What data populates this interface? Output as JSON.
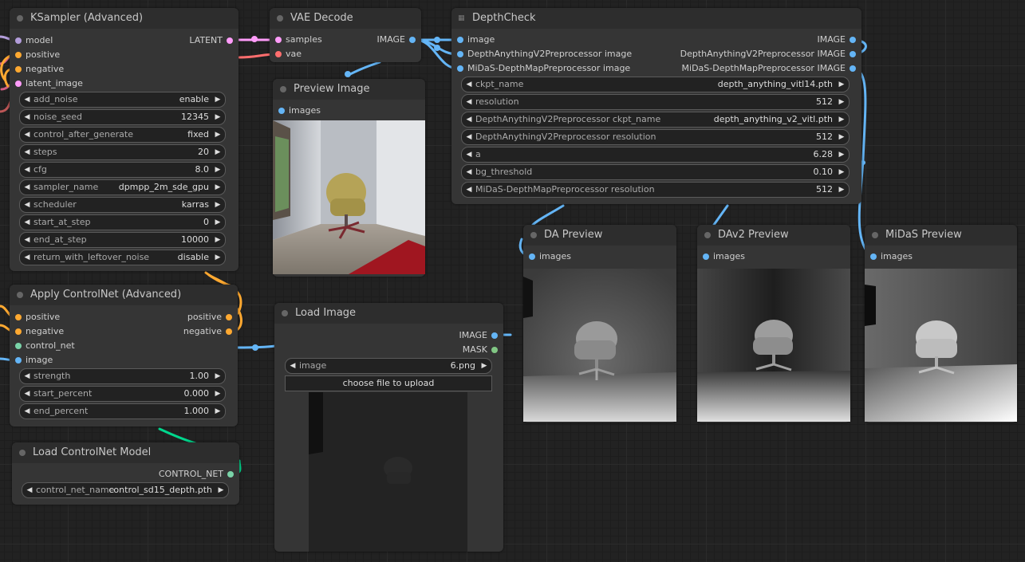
{
  "colors": {
    "model": "#b39ddb",
    "conditioning": "#ffa931",
    "latent": "#ff9cf9",
    "vae": "#ff6e6e",
    "image": "#64b5f6",
    "mask": "#81c784",
    "control_net": "#00d78d"
  },
  "ksampler": {
    "title": "KSampler (Advanced)",
    "inputs": [
      "model",
      "positive",
      "negative",
      "latent_image"
    ],
    "output": "LATENT",
    "widgets": [
      {
        "label": "add_noise",
        "value": "enable"
      },
      {
        "label": "noise_seed",
        "value": "12345"
      },
      {
        "label": "control_after_generate",
        "value": "fixed"
      },
      {
        "label": "steps",
        "value": "20"
      },
      {
        "label": "cfg",
        "value": "8.0"
      },
      {
        "label": "sampler_name",
        "value": "dpmpp_2m_sde_gpu"
      },
      {
        "label": "scheduler",
        "value": "karras"
      },
      {
        "label": "start_at_step",
        "value": "0"
      },
      {
        "label": "end_at_step",
        "value": "10000"
      },
      {
        "label": "return_with_leftover_noise",
        "value": "disable"
      }
    ]
  },
  "vae_decode": {
    "title": "VAE Decode",
    "inputs": [
      "samples",
      "vae"
    ],
    "output": "IMAGE"
  },
  "preview_image": {
    "title": "Preview Image",
    "input": "images"
  },
  "depth_check": {
    "title": "DepthCheck",
    "inputs": [
      "image",
      "DepthAnythingV2Preprocessor image",
      "MiDaS-DepthMapPreprocessor image"
    ],
    "outputs": [
      "IMAGE",
      "DepthAnythingV2Preprocessor IMAGE",
      "MiDaS-DepthMapPreprocessor IMAGE"
    ],
    "widgets": [
      {
        "label": "ckpt_name",
        "value": "depth_anything_vitl14.pth"
      },
      {
        "label": "resolution",
        "value": "512"
      },
      {
        "label": "DepthAnythingV2Preprocessor ckpt_name",
        "value": "depth_anything_v2_vitl.pth"
      },
      {
        "label": "DepthAnythingV2Preprocessor resolution",
        "value": "512"
      },
      {
        "label": "a",
        "value": "6.28"
      },
      {
        "label": "bg_threshold",
        "value": "0.10"
      },
      {
        "label": "MiDaS-DepthMapPreprocessor resolution",
        "value": "512"
      }
    ]
  },
  "apply_controlnet": {
    "title": "Apply ControlNet (Advanced)",
    "inputs": [
      "positive",
      "negative",
      "control_net",
      "image"
    ],
    "outputs": [
      "positive",
      "negative"
    ],
    "widgets": [
      {
        "label": "strength",
        "value": "1.00"
      },
      {
        "label": "start_percent",
        "value": "0.000"
      },
      {
        "label": "end_percent",
        "value": "1.000"
      }
    ]
  },
  "load_controlnet": {
    "title": "Load ControlNet Model",
    "output": "CONTROL_NET",
    "widget": {
      "label": "control_net_name",
      "value": "control_sd15_depth.pth"
    }
  },
  "load_image": {
    "title": "Load Image",
    "outputs": [
      "IMAGE",
      "MASK"
    ],
    "widget": {
      "label": "image",
      "value": "6.png"
    },
    "upload_label": "choose file to upload"
  },
  "da_preview": {
    "title": "DA Preview",
    "input": "images"
  },
  "dav2_preview": {
    "title": "DAv2 Preview",
    "input": "images"
  },
  "midas_preview": {
    "title": "MiDaS Preview",
    "input": "images"
  }
}
